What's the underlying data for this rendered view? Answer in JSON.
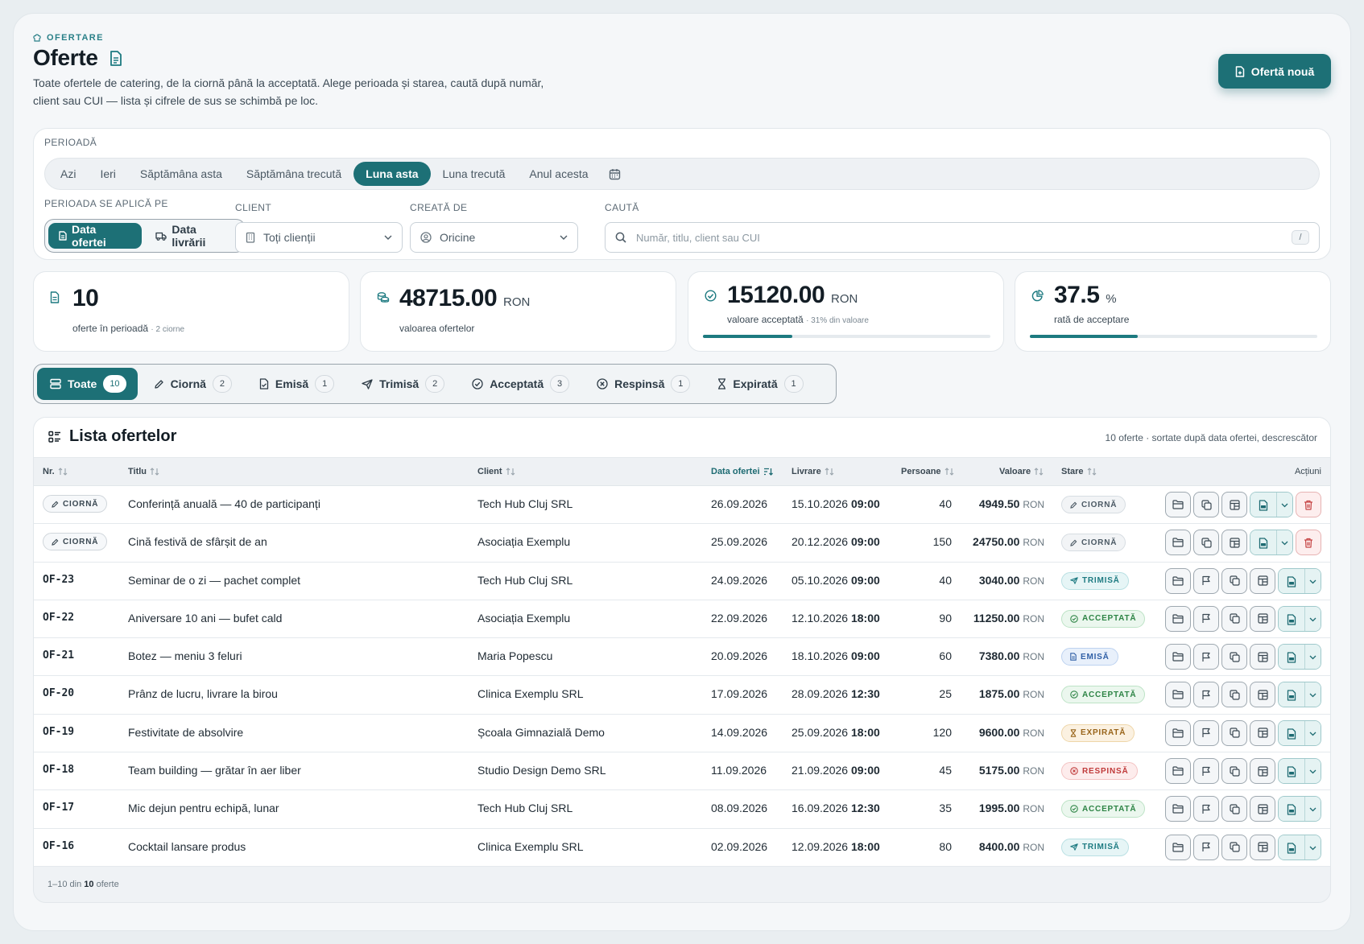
{
  "header": {
    "eyebrow": "OFERTARE",
    "title": "Oferte",
    "lead": "Toate ofertele de catering, de la ciornă până la acceptată. Alege perioada și starea, caută după număr, client sau CUI — lista și cifrele de sus se schimbă pe loc.",
    "new_button": "Ofertă nouă"
  },
  "filters": {
    "period_label": "PERIOADĂ",
    "periods": [
      "Azi",
      "Ieri",
      "Săptămâna asta",
      "Săptămâna trecută",
      "Luna asta",
      "Luna trecută",
      "Anul acesta"
    ],
    "active_period": "Luna asta",
    "applies_label": "PERIOADA SE APLICĂ PE",
    "applies_options": [
      "Data ofertei",
      "Data livrării"
    ],
    "client_label": "CLIENT",
    "client_value": "Toți clienții",
    "created_label": "CREATĂ DE",
    "created_value": "Oricine",
    "search_label": "CAUTĂ",
    "search_placeholder": "Număr, titlu, client sau CUI",
    "search_shortcut": "/"
  },
  "stats": {
    "count": {
      "value": "10",
      "label": "oferte în perioadă",
      "note": "· 2 ciorne"
    },
    "total": {
      "value": "48715.00",
      "unit": "RON",
      "label": "valoarea ofertelor"
    },
    "accepted": {
      "value": "15120.00",
      "unit": "RON",
      "label": "valoare acceptată",
      "note": "· 31% din valoare",
      "fraction": 0.31
    },
    "rate": {
      "value": "37.5",
      "unit": "%",
      "label": "rată de acceptare",
      "fraction": 0.375
    }
  },
  "status_tabs": [
    {
      "label": "Toate",
      "count": "10"
    },
    {
      "label": "Ciornă",
      "count": "2"
    },
    {
      "label": "Emisă",
      "count": "1"
    },
    {
      "label": "Trimisă",
      "count": "2"
    },
    {
      "label": "Acceptată",
      "count": "3"
    },
    {
      "label": "Respinsă",
      "count": "1"
    },
    {
      "label": "Expirată",
      "count": "1"
    }
  ],
  "list": {
    "title": "Lista ofertelor",
    "meta": "10 oferte · sortate după data ofertei, descrescător",
    "columns": {
      "nr": "Nr.",
      "title": "Titlu",
      "client": "Client",
      "date": "Data ofertei",
      "delivery": "Livrare",
      "persons": "Persoane",
      "value": "Valoare",
      "status": "Stare",
      "actions": "Acțiuni"
    },
    "currency": "RON",
    "rows": [
      {
        "nr": "CIORNĂ",
        "draft": true,
        "title": "Conferință anuală — 40 de participanți",
        "client": "Tech Hub Cluj SRL",
        "date": "26.09.2026",
        "delivery_date": "15.10.2026",
        "delivery_time": "09:00",
        "persons": "40",
        "value": "4949.50",
        "status": "CIORNĂ",
        "status_key": "ciorna"
      },
      {
        "nr": "CIORNĂ",
        "draft": true,
        "title": "Cină festivă de sfârșit de an",
        "client": "Asociația Exemplu",
        "date": "25.09.2026",
        "delivery_date": "20.12.2026",
        "delivery_time": "09:00",
        "persons": "150",
        "value": "24750.00",
        "status": "CIORNĂ",
        "status_key": "ciorna"
      },
      {
        "nr": "OF-23",
        "title": "Seminar de o zi — pachet complet",
        "client": "Tech Hub Cluj SRL",
        "date": "24.09.2026",
        "delivery_date": "05.10.2026",
        "delivery_time": "09:00",
        "persons": "40",
        "value": "3040.00",
        "status": "TRIMISĂ",
        "status_key": "trimisa"
      },
      {
        "nr": "OF-22",
        "title": "Aniversare 10 ani — bufet cald",
        "client": "Asociația Exemplu",
        "date": "22.09.2026",
        "delivery_date": "12.10.2026",
        "delivery_time": "18:00",
        "persons": "90",
        "value": "11250.00",
        "status": "ACCEPTATĂ",
        "status_key": "acceptata"
      },
      {
        "nr": "OF-21",
        "title": "Botez — meniu 3 feluri",
        "client": "Maria Popescu",
        "date": "20.09.2026",
        "delivery_date": "18.10.2026",
        "delivery_time": "09:00",
        "persons": "60",
        "value": "7380.00",
        "status": "EMISĂ",
        "status_key": "emisa"
      },
      {
        "nr": "OF-20",
        "title": "Prânz de lucru, livrare la birou",
        "client": "Clinica Exemplu SRL",
        "date": "17.09.2026",
        "delivery_date": "28.09.2026",
        "delivery_time": "12:30",
        "persons": "25",
        "value": "1875.00",
        "status": "ACCEPTATĂ",
        "status_key": "acceptata"
      },
      {
        "nr": "OF-19",
        "title": "Festivitate de absolvire",
        "client": "Școala Gimnazială Demo",
        "date": "14.09.2026",
        "delivery_date": "25.09.2026",
        "delivery_time": "18:00",
        "persons": "120",
        "value": "9600.00",
        "status": "EXPIRATĂ",
        "status_key": "expirata"
      },
      {
        "nr": "OF-18",
        "title": "Team building — grătar în aer liber",
        "client": "Studio Design Demo SRL",
        "date": "11.09.2026",
        "delivery_date": "21.09.2026",
        "delivery_time": "09:00",
        "persons": "45",
        "value": "5175.00",
        "status": "RESPINSĂ",
        "status_key": "respinsa"
      },
      {
        "nr": "OF-17",
        "title": "Mic dejun pentru echipă, lunar",
        "client": "Tech Hub Cluj SRL",
        "date": "08.09.2026",
        "delivery_date": "16.09.2026",
        "delivery_time": "12:30",
        "persons": "35",
        "value": "1995.00",
        "status": "ACCEPTATĂ",
        "status_key": "acceptata"
      },
      {
        "nr": "OF-16",
        "title": "Cocktail lansare produs",
        "client": "Clinica Exemplu SRL",
        "date": "02.09.2026",
        "delivery_date": "12.09.2026",
        "delivery_time": "18:00",
        "persons": "80",
        "value": "8400.00",
        "status": "TRIMISĂ",
        "status_key": "trimisa"
      }
    ],
    "footer": {
      "range": "1–10 din",
      "total": "10",
      "suffix": "oferte"
    }
  }
}
